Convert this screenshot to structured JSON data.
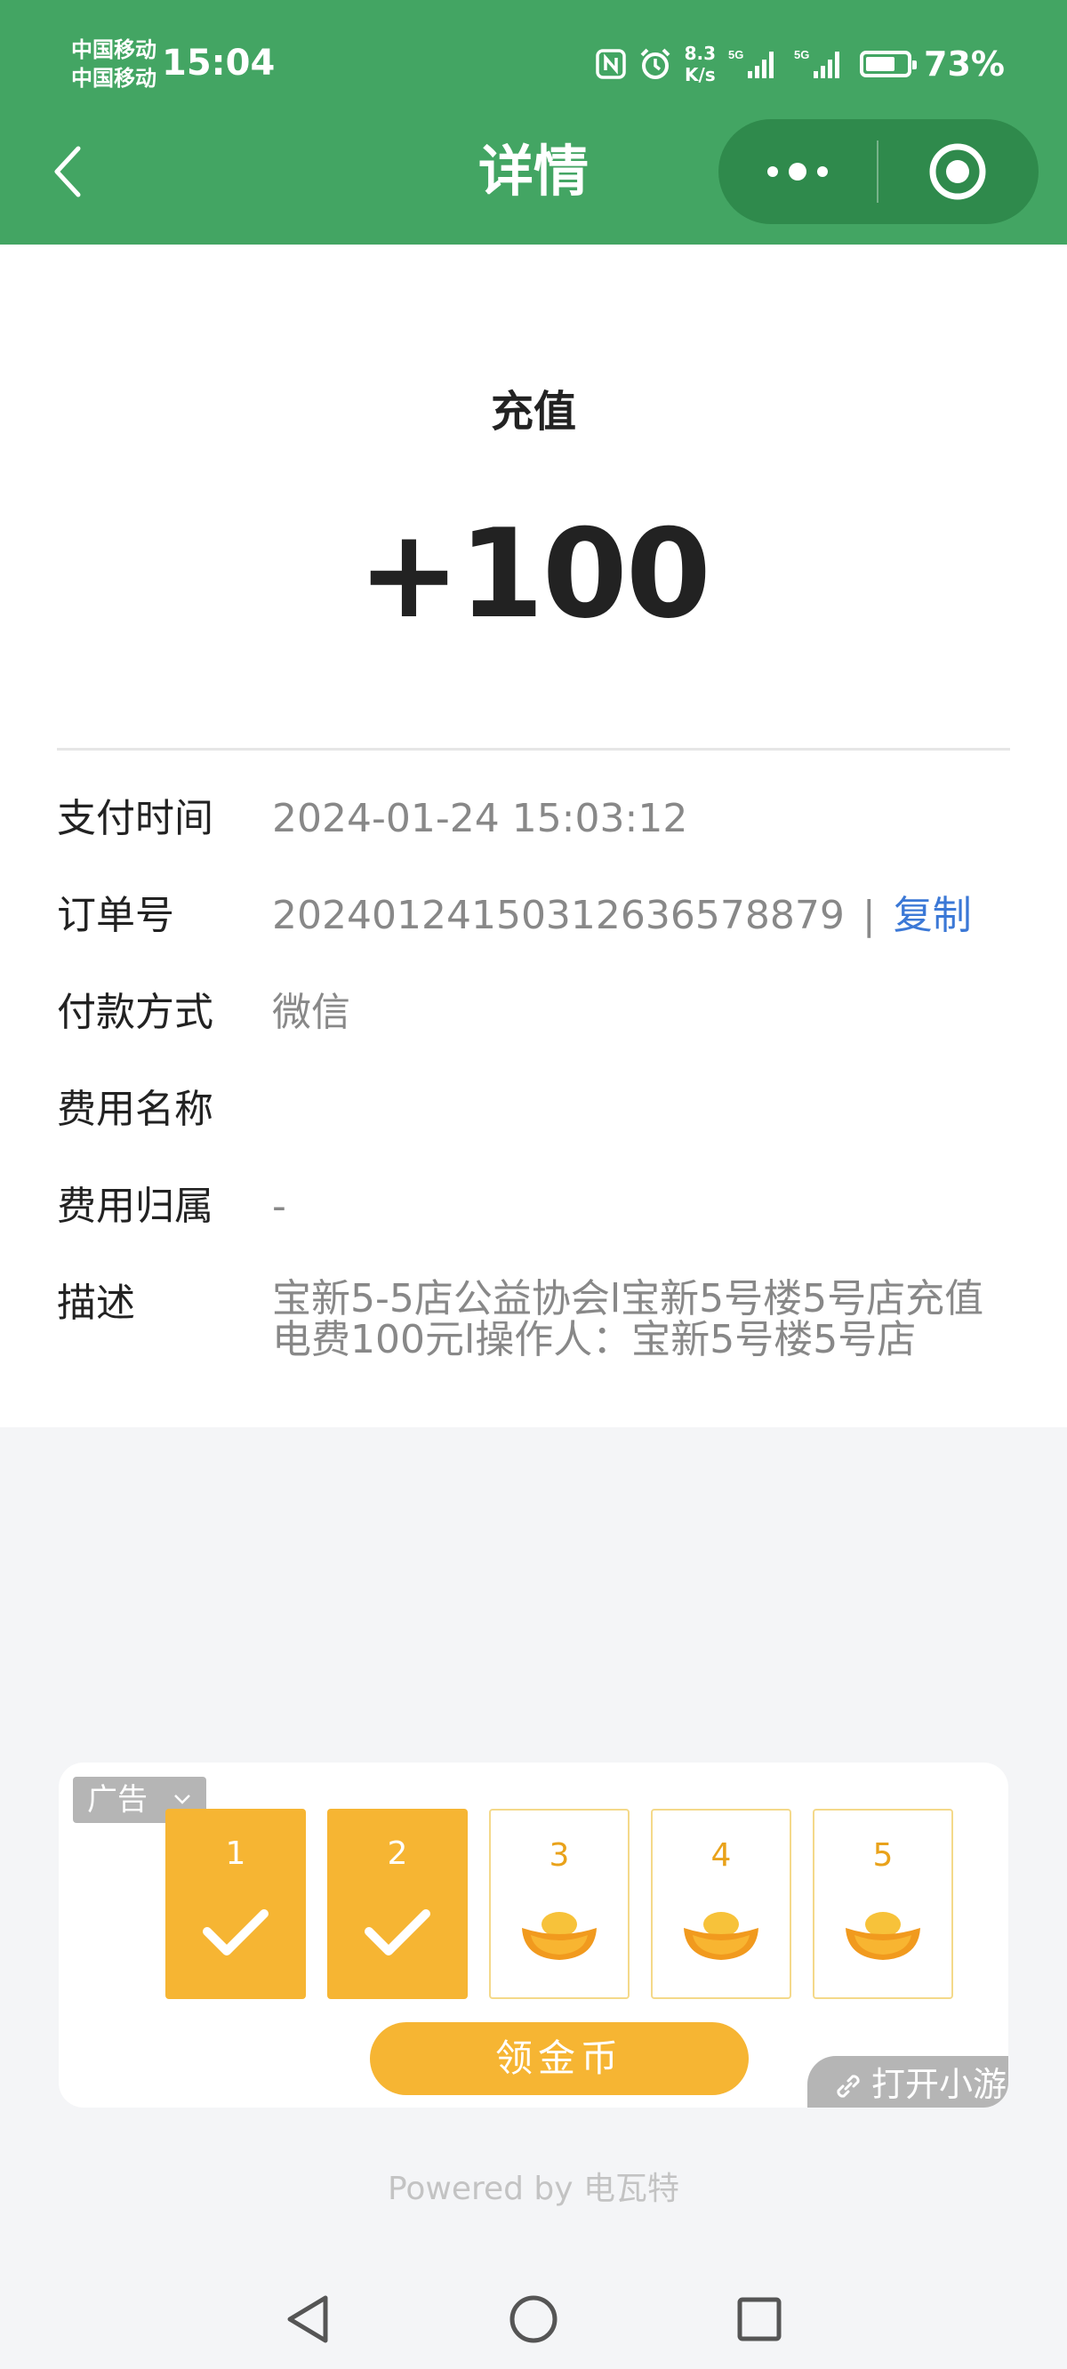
{
  "status_bar": {
    "carrier_1": "中国移动",
    "carrier_2": "中国移动",
    "time": "15:04",
    "net_speed_value": "8.3",
    "net_speed_unit": "K/s",
    "signal_1_label": "5G",
    "signal_2_label": "5G",
    "battery_percent": "73%",
    "battery_level": 0.73
  },
  "nav": {
    "title": "详情"
  },
  "transaction": {
    "type": "充值",
    "amount": "+100"
  },
  "details": [
    {
      "label": "支付时间",
      "value": "2024-01-24 15:03:12"
    },
    {
      "label": "订单号",
      "value": "20240124150312636578879",
      "separator": "|",
      "action": "复制"
    },
    {
      "label": "付款方式",
      "value": "微信"
    },
    {
      "label": "费用名称",
      "value": ""
    },
    {
      "label": "费用归属",
      "value": "-"
    },
    {
      "label": "描述",
      "value": "宝新5-5店公益协会l宝新5号楼5号店充值电费100元l操作人：宝新5号楼5号店"
    }
  ],
  "ad": {
    "tag": "广告",
    "days": [
      {
        "num": "1",
        "claimed": true
      },
      {
        "num": "2",
        "claimed": true
      },
      {
        "num": "3",
        "claimed": false
      },
      {
        "num": "4",
        "claimed": false
      },
      {
        "num": "5",
        "claimed": false
      }
    ],
    "claim_button": "领金币",
    "open_game": "打开小游",
    "colors": {
      "accent": "#f6b533",
      "ingot": "#f19a1e"
    }
  },
  "footer": {
    "powered_by": "Powered by 电瓦特"
  },
  "colors": {
    "header_green": "#43a563",
    "link_blue": "#3b78d6"
  }
}
